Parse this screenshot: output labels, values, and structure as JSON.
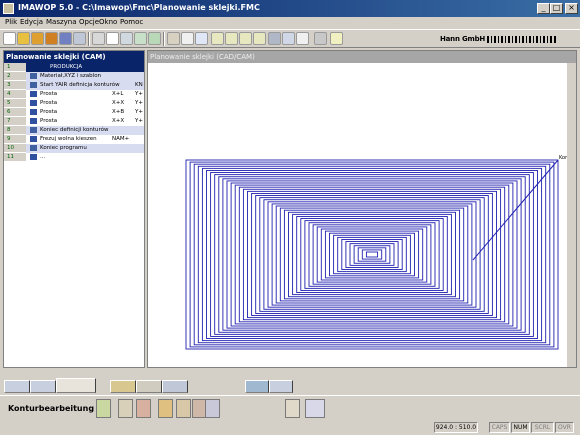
{
  "window": {
    "title": "IMAWOP 5.0 - C:\\Imawop\\Fmc\\Planowanie sklejki.FMC"
  },
  "menu": [
    "Plik",
    "Edycja",
    "Maszyna",
    "Opcje",
    "Okno",
    "Pomoc"
  ],
  "toolbar": {
    "brand_text": "Hann GmbH",
    "icons": [
      "new-icon",
      "open-icon",
      "open-recent-icon",
      "open-folder-icon",
      "save-icon",
      "save-as-icon",
      "cut-icon",
      "copy-icon",
      "paste-icon",
      "undo-icon",
      "redo-icon",
      "print-icon",
      "print-preview-icon",
      "cnc-icon",
      "zoom-icon",
      "zoom-in-icon",
      "zoom-out-icon",
      "zoom-all-icon",
      "sim-icon",
      "3d-icon",
      "pen-icon",
      "calculator-icon",
      "help-icon"
    ]
  },
  "left_panel": {
    "title": "Planowanie sklejki (CAM)",
    "rows": [
      {
        "num": "1",
        "label": "PRODUKCJA",
        "c1": "",
        "c2": "",
        "style": "highlight"
      },
      {
        "num": "2",
        "label": "Materiał,XYZ i szablon",
        "c1": "",
        "c2": "",
        "style": "section"
      },
      {
        "num": "3",
        "label": "Start YAIR definicja konturów",
        "c1": "",
        "c2": "KN",
        "style": "section"
      },
      {
        "num": "4",
        "label": "Prosta",
        "c1": "X+L",
        "c2": "Y+",
        "style": "plain"
      },
      {
        "num": "5",
        "label": "Prosta",
        "c1": "X+X",
        "c2": "Y+",
        "style": "plain"
      },
      {
        "num": "6",
        "label": "Prosta",
        "c1": "X+B",
        "c2": "Y+",
        "style": "plain"
      },
      {
        "num": "7",
        "label": "Prosta",
        "c1": "X+X",
        "c2": "Y+",
        "style": "plain"
      },
      {
        "num": "8",
        "label": "Koniec definicji konturów",
        "c1": "",
        "c2": "",
        "style": "section"
      },
      {
        "num": "9",
        "label": "Frezuj wolna kieszen",
        "c1": "NAM+",
        "c2": "",
        "style": "plain"
      },
      {
        "num": "10",
        "label": "Koniec programu",
        "c1": "",
        "c2": "",
        "style": "section"
      },
      {
        "num": "11",
        "label": "...",
        "c1": "",
        "c2": "",
        "style": "plain"
      }
    ]
  },
  "canvas_panel": {
    "title": "Planowanie sklejki (CAD/CAM)",
    "end_label": "Kor",
    "path_color": "#2020b0",
    "loop_count": 46
  },
  "context_bar": {
    "label": "Konturbearbeitung"
  },
  "status": {
    "coords": "924.0 : 510.0",
    "caps": "CAPS",
    "num": "NUM",
    "scrl": "SCRL",
    "ovr": "OVR"
  }
}
